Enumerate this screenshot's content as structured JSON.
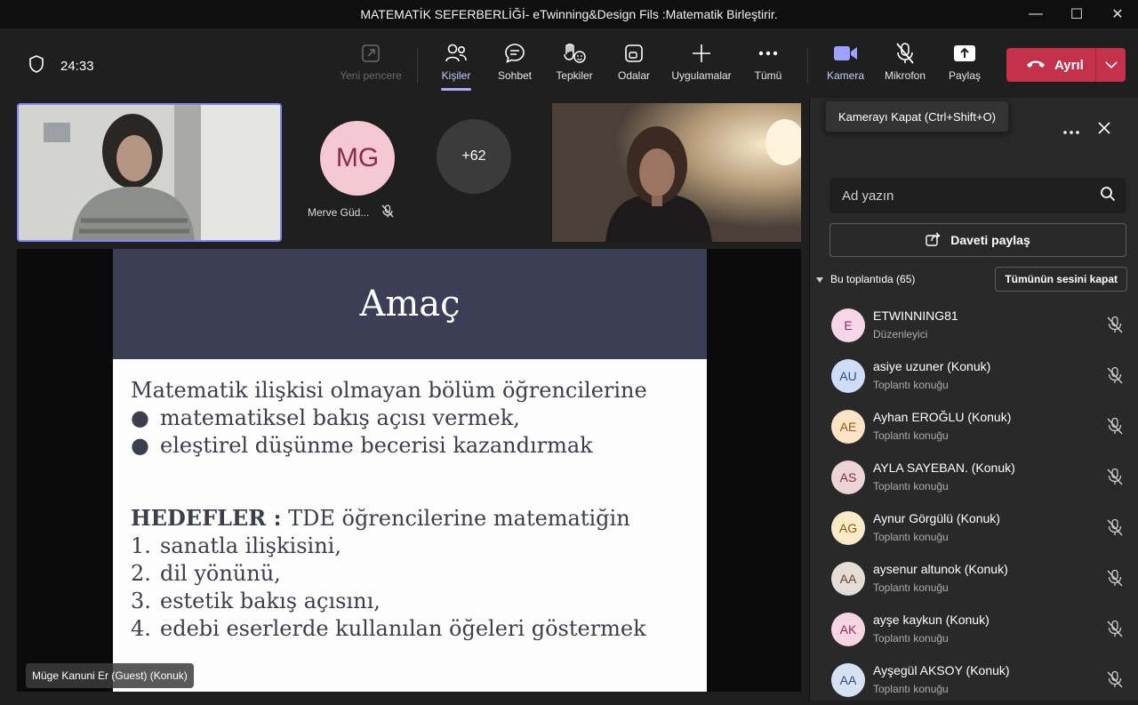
{
  "window": {
    "title": "MATEMATİK SEFERBERLİĞİ- eTwinning&Design Fils :Matematik Birleştirir.",
    "controls": {
      "minimize": "—",
      "maximize": "☐",
      "close": "✕"
    }
  },
  "meeting": {
    "timer": "24:33"
  },
  "toolbar": {
    "new_window": "Yeni pencere",
    "people": "Kişiler",
    "chat": "Sohbet",
    "reactions": "Tepkiler",
    "rooms": "Odalar",
    "apps": "Uygulamalar",
    "more": "Tümü",
    "camera": "Kamera",
    "mic": "Mikrofon",
    "share": "Paylaş",
    "leave": "Ayrıl",
    "accent": "#c4314b"
  },
  "stage": {
    "participant_initials": "MG",
    "participant_name": "Merve Güd...",
    "more_count": "+62",
    "presenter": "Müge Kanuni Er (Guest) (Konuk)"
  },
  "slide": {
    "title": "Amaç",
    "intro": "Matematik ilişkisi olmayan bölüm öğrencilerine",
    "bullets": [
      "matematiksel bakış açısı vermek,",
      "eleştirel düşünme becerisi kazandırmak"
    ],
    "goals_label": "HEDEFLER :",
    "goals_intro": "TDE öğrencilerine matematiğin",
    "goals": [
      {
        "num": "1.",
        "text": "sanatla ilişkisini,"
      },
      {
        "num": "2.",
        "text": "dil yönünü,"
      },
      {
        "num": "3.",
        "text": "estetik bakış açısını,"
      },
      {
        "num": "4.",
        "text": "edebi eserlerde kullanılan öğeleri göstermek"
      }
    ]
  },
  "panel": {
    "tooltip": "Kamerayı Kapat (Ctrl+Shift+O)",
    "search_placeholder": "Ad yazın",
    "share_invite": "Daveti paylaş",
    "section_label": "Bu toplantıda (65)",
    "mute_all": "Tümünün sesini kapat",
    "participants": [
      {
        "initials": "E",
        "name": "ETWINNING81",
        "role": "Düzenleyici",
        "bg": "#f4d6e6",
        "fg": "#8b2c62"
      },
      {
        "initials": "AU",
        "name": "asiye uzuner (Konuk)",
        "role": "Toplantı konuğu",
        "bg": "#cfdcf5",
        "fg": "#2c4a8b"
      },
      {
        "initials": "AE",
        "name": "Ayhan EROĞLU (Konuk)",
        "role": "Toplantı konuğu",
        "bg": "#fbe3c4",
        "fg": "#8b5a1c"
      },
      {
        "initials": "AS",
        "name": "AYLA SAYEBAN. (Konuk)",
        "role": "Toplantı konuğu",
        "bg": "#ecd3d6",
        "fg": "#7a3040"
      },
      {
        "initials": "AG",
        "name": "Aynur Görgülü (Konuk)",
        "role": "Toplantı konuğu",
        "bg": "#f9e9c4",
        "fg": "#7d5c16"
      },
      {
        "initials": "AA",
        "name": "aysenur altunok (Konuk)",
        "role": "Toplantı konuğu",
        "bg": "#e6dcd6",
        "fg": "#5a4336"
      },
      {
        "initials": "AK",
        "name": "ayşe kaykun (Konuk)",
        "role": "Toplantı konuğu",
        "bg": "#f7d4e2",
        "fg": "#8b2c5a"
      },
      {
        "initials": "AA",
        "name": "Ayşegül AKSOY (Konuk)",
        "role": "Toplantı konuğu",
        "bg": "#d6e2f2",
        "fg": "#2c4a7a"
      }
    ]
  }
}
